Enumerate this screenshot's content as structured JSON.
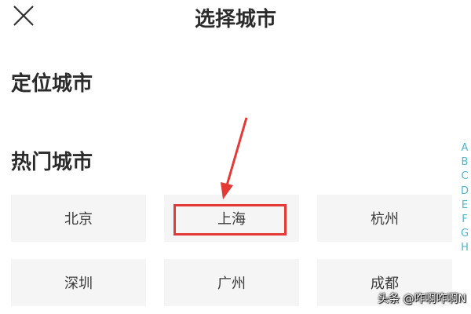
{
  "header": {
    "title": "选择城市",
    "close_icon": "close-icon"
  },
  "sections": {
    "located_title": "定位城市",
    "hot_title": "热门城市"
  },
  "hot_cities": [
    "北京",
    "上海",
    "杭州",
    "深圳",
    "广州",
    "成都"
  ],
  "index_letters": [
    "A",
    "B",
    "C",
    "D",
    "E",
    "F",
    "G",
    "H"
  ],
  "annotation": {
    "highlight_color": "#e53935",
    "highlighted_city": "上海"
  },
  "watermark": "头条 @咋啊咋啊N",
  "colors": {
    "index_letter": "#4fb6cf",
    "city_button_bg": "#f5f5f5"
  }
}
